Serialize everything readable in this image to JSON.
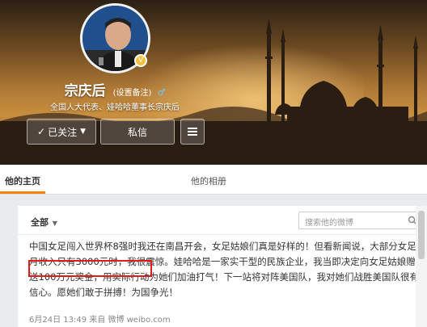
{
  "profile": {
    "name": "宗庆后",
    "remark_link": "(设置备注)",
    "gender_symbol": "♂",
    "bio": "全国人大代表、娃哈哈董事长宗庆后"
  },
  "actions": {
    "follow_label": "已关注",
    "message_label": "私信"
  },
  "tabs": [
    {
      "label": "他的主页",
      "active": true
    },
    {
      "label": "他的相册",
      "active": false
    }
  ],
  "feed": {
    "filter_label": "全部",
    "search_placeholder": "搜索他的微博"
  },
  "post": {
    "text": "中国女足闯入世界杯8强时我还在南昌开会，女足姑娘们真是好样的！但看新闻说，大部分女足月收入只有3000元时，我很震惊。娃哈哈是一家实干型的民族企业，我当即决定向女足姑娘赠送100万元奖金，用实际行动为她们加油打气！下一站将对阵美国队，我对她们战胜美国队很有信心。愿她们敢于拼搏！为国争光！",
    "meta": "6月24日 13:49 来自 微博 weibo.com"
  },
  "colors": {
    "accent_orange": "#ff8200",
    "highlight_red": "#e11b1b"
  }
}
